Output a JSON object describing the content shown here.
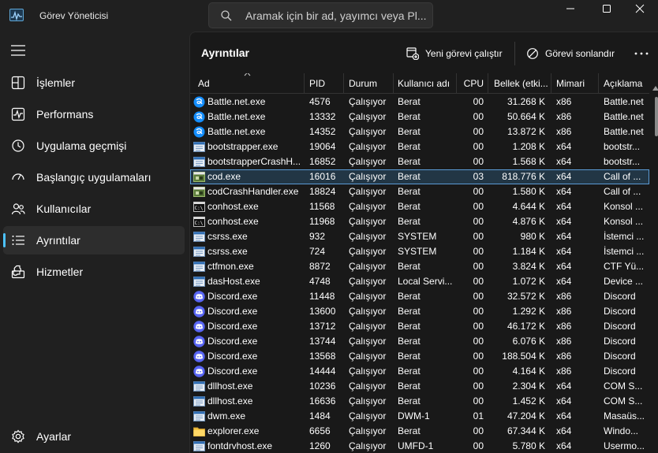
{
  "app": {
    "title": "Görev Yöneticisi"
  },
  "search": {
    "placeholder": "Aramak için bir ad, yayımcı veya Pl..."
  },
  "nav": [
    {
      "label": "İşlemler",
      "icon": "processes-icon"
    },
    {
      "label": "Performans",
      "icon": "performance-icon"
    },
    {
      "label": "Uygulama geçmişi",
      "icon": "app-history-icon"
    },
    {
      "label": "Başlangıç uygulamaları",
      "icon": "startup-apps-icon"
    },
    {
      "label": "Kullanıcılar",
      "icon": "users-icon"
    },
    {
      "label": "Ayrıntılar",
      "icon": "details-icon",
      "active": true
    },
    {
      "label": "Hizmetler",
      "icon": "services-icon"
    }
  ],
  "settings": {
    "label": "Ayarlar"
  },
  "toolbar": {
    "title": "Ayrıntılar",
    "run_task": "Yeni görevi çalıştır",
    "end_task": "Görevi sonlandır"
  },
  "columns": [
    "Ad",
    "PID",
    "Durum",
    "Kullanıcı adı",
    "CPU",
    "Bellek (etki...",
    "Mimari",
    "Açıklama"
  ],
  "rows": [
    [
      "Battle.net.exe",
      "4576",
      "Çalışıyor",
      "Berat",
      "00",
      "31.268 K",
      "x86",
      "Battle.net",
      "battle"
    ],
    [
      "Battle.net.exe",
      "13332",
      "Çalışıyor",
      "Berat",
      "00",
      "50.664 K",
      "x86",
      "Battle.net",
      "battle"
    ],
    [
      "Battle.net.exe",
      "14352",
      "Çalışıyor",
      "Berat",
      "00",
      "13.872 K",
      "x86",
      "Battle.net",
      "battle"
    ],
    [
      "bootstrapper.exe",
      "19064",
      "Çalışıyor",
      "Berat",
      "00",
      "1.208 K",
      "x64",
      "bootstr...",
      "window"
    ],
    [
      "bootstrapperCrashH...",
      "16852",
      "Çalışıyor",
      "Berat",
      "00",
      "1.568 K",
      "x64",
      "bootstr...",
      "window"
    ],
    [
      "cod.exe",
      "16016",
      "Çalışıyor",
      "Berat",
      "03",
      "818.776 K",
      "x64",
      "Call of ...",
      "game"
    ],
    [
      "codCrashHandler.exe",
      "18824",
      "Çalışıyor",
      "Berat",
      "00",
      "1.580 K",
      "x64",
      "Call of ...",
      "game"
    ],
    [
      "conhost.exe",
      "11568",
      "Çalışıyor",
      "Berat",
      "00",
      "4.644 K",
      "x64",
      "Konsol ...",
      "console"
    ],
    [
      "conhost.exe",
      "11968",
      "Çalışıyor",
      "Berat",
      "00",
      "4.876 K",
      "x64",
      "Konsol ...",
      "console"
    ],
    [
      "csrss.exe",
      "932",
      "Çalışıyor",
      "SYSTEM",
      "00",
      "980 K",
      "x64",
      "İstemci ...",
      "window"
    ],
    [
      "csrss.exe",
      "724",
      "Çalışıyor",
      "SYSTEM",
      "00",
      "1.184 K",
      "x64",
      "İstemci ...",
      "window"
    ],
    [
      "ctfmon.exe",
      "8872",
      "Çalışıyor",
      "Berat",
      "00",
      "3.824 K",
      "x64",
      "CTF Yü...",
      "window"
    ],
    [
      "dasHost.exe",
      "4748",
      "Çalışıyor",
      "Local Servi...",
      "00",
      "1.072 K",
      "x64",
      "Device ...",
      "window"
    ],
    [
      "Discord.exe",
      "11448",
      "Çalışıyor",
      "Berat",
      "00",
      "32.572 K",
      "x86",
      "Discord",
      "discord"
    ],
    [
      "Discord.exe",
      "13600",
      "Çalışıyor",
      "Berat",
      "00",
      "1.292 K",
      "x86",
      "Discord",
      "discord"
    ],
    [
      "Discord.exe",
      "13712",
      "Çalışıyor",
      "Berat",
      "00",
      "46.172 K",
      "x86",
      "Discord",
      "discord"
    ],
    [
      "Discord.exe",
      "13744",
      "Çalışıyor",
      "Berat",
      "00",
      "6.076 K",
      "x86",
      "Discord",
      "discord"
    ],
    [
      "Discord.exe",
      "13568",
      "Çalışıyor",
      "Berat",
      "00",
      "188.504 K",
      "x86",
      "Discord",
      "discord"
    ],
    [
      "Discord.exe",
      "14444",
      "Çalışıyor",
      "Berat",
      "00",
      "4.164 K",
      "x86",
      "Discord",
      "discord"
    ],
    [
      "dllhost.exe",
      "10236",
      "Çalışıyor",
      "Berat",
      "00",
      "2.304 K",
      "x64",
      "COM S...",
      "window"
    ],
    [
      "dllhost.exe",
      "16636",
      "Çalışıyor",
      "Berat",
      "00",
      "1.452 K",
      "x64",
      "COM S...",
      "window"
    ],
    [
      "dwm.exe",
      "1484",
      "Çalışıyor",
      "DWM-1",
      "01",
      "47.204 K",
      "x64",
      "Masaüs...",
      "window"
    ],
    [
      "explorer.exe",
      "6656",
      "Çalışıyor",
      "Berat",
      "00",
      "67.344 K",
      "x64",
      "Windo...",
      "folder"
    ],
    [
      "fontdrvhost.exe",
      "1260",
      "Çalışıyor",
      "UMFD-1",
      "00",
      "5.780 K",
      "x64",
      "Usermo...",
      "window"
    ]
  ],
  "selected_row": 5,
  "colors": {
    "accent": "#4cc2ff",
    "selection": "#223645",
    "discord": "#5865f2",
    "battle": "#148eff"
  }
}
